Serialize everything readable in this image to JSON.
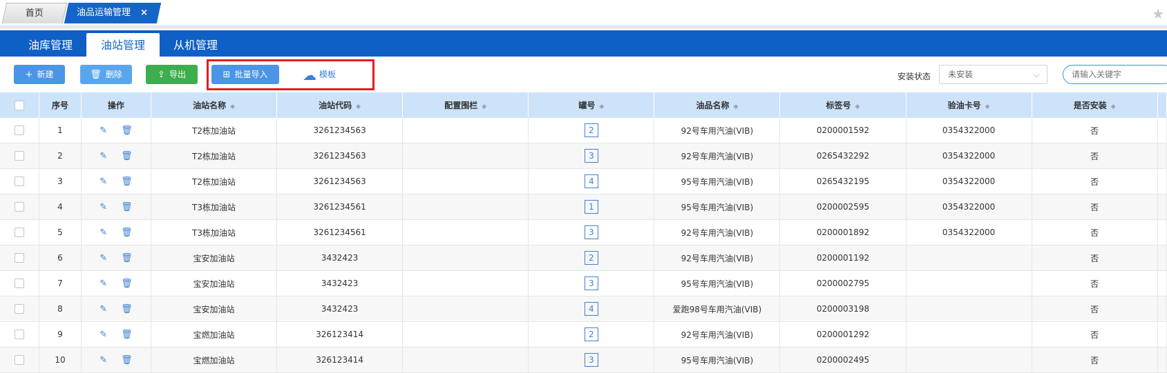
{
  "page_tabs": {
    "home": "首页",
    "active": "油品运输管理",
    "close": "×"
  },
  "module_tabs": [
    "油库管理",
    "油站管理",
    "从机管理"
  ],
  "toolbar": {
    "add": "新建",
    "delete": "删除",
    "export": "导出",
    "import": "批量导入",
    "template": "模板"
  },
  "filter": {
    "label": "安装状态",
    "status_value": "未安装",
    "search_placeholder": "请输入关键字"
  },
  "table": {
    "columns": [
      "序号",
      "操作",
      "油站名称",
      "油站代码",
      "配置围栏",
      "罐号",
      "油品名称",
      "标签号",
      "验油卡号",
      "是否安装"
    ],
    "rows": [
      {
        "idx": "1",
        "station": "T2栋加油站",
        "code": "3261234563",
        "fence": "",
        "tank": "2",
        "product": "92号车用汽油(VIB)",
        "tag": "0200001592",
        "card": "0354322000",
        "installed": "否"
      },
      {
        "idx": "2",
        "station": "T2栋加油站",
        "code": "3261234563",
        "fence": "",
        "tank": "3",
        "product": "92号车用汽油(VIB)",
        "tag": "0265432292",
        "card": "0354322000",
        "installed": "否"
      },
      {
        "idx": "3",
        "station": "T2栋加油站",
        "code": "3261234563",
        "fence": "",
        "tank": "4",
        "product": "95号车用汽油(VIB)",
        "tag": "0265432195",
        "card": "0354322000",
        "installed": "否"
      },
      {
        "idx": "4",
        "station": "T3栋加油站",
        "code": "3261234561",
        "fence": "",
        "tank": "1",
        "product": "95号车用汽油(VIB)",
        "tag": "0200002595",
        "card": "0354322000",
        "installed": "否"
      },
      {
        "idx": "5",
        "station": "T3栋加油站",
        "code": "3261234561",
        "fence": "",
        "tank": "3",
        "product": "92号车用汽油(VIB)",
        "tag": "0200001892",
        "card": "0354322000",
        "installed": "否"
      },
      {
        "idx": "6",
        "station": "宝安加油站",
        "code": "3432423",
        "fence": "",
        "tank": "2",
        "product": "92号车用汽油(VIB)",
        "tag": "0200001192",
        "card": "",
        "installed": "否"
      },
      {
        "idx": "7",
        "station": "宝安加油站",
        "code": "3432423",
        "fence": "",
        "tank": "3",
        "product": "95号车用汽油(VIB)",
        "tag": "0200002795",
        "card": "",
        "installed": "否"
      },
      {
        "idx": "8",
        "station": "宝安加油站",
        "code": "3432423",
        "fence": "",
        "tank": "4",
        "product": "爱跑98号车用汽油(VIB)",
        "tag": "0200003198",
        "card": "",
        "installed": "否"
      },
      {
        "idx": "9",
        "station": "宝燃加油站",
        "code": "326123414",
        "fence": "",
        "tank": "2",
        "product": "92号车用汽油(VIB)",
        "tag": "0200001292",
        "card": "",
        "installed": "否"
      },
      {
        "idx": "10",
        "station": "宝燃加油站",
        "code": "326123414",
        "fence": "",
        "tank": "3",
        "product": "95号车用汽油(VIB)",
        "tag": "0200002495",
        "card": "",
        "installed": "否"
      }
    ]
  },
  "icons": {
    "edit": "edit-icon",
    "delete": "trash-icon",
    "star": "star-icon",
    "cloud": "cloud-download-icon"
  },
  "colors": {
    "primary": "#1565c8",
    "button_blue": "#4a95e6",
    "button_green": "#3cae4d",
    "header_bg": "#cde3fa",
    "highlight_red": "#e31b23",
    "no_red": "#d9322c"
  }
}
